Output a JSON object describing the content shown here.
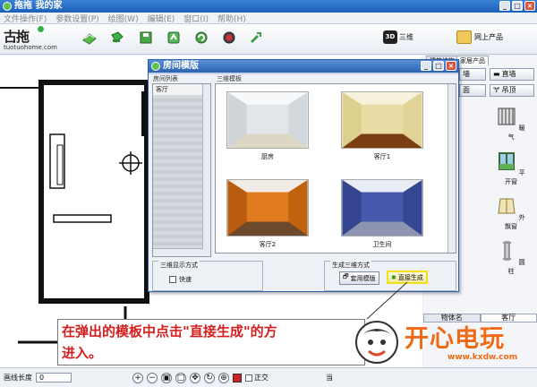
{
  "window": {
    "title": "拖拖 我的家"
  },
  "menu": {
    "items": [
      "文件操作(F)",
      "参数设置(P)",
      "绘图(W)",
      "编辑(E)",
      "窗口(I)",
      "帮助(H)"
    ]
  },
  "logo": {
    "mark": "古拖",
    "site": "tuotuohome.com"
  },
  "toolbar": {
    "view3d_badge": "3D",
    "view3d_label": "三维",
    "shop_label": "网上产品"
  },
  "right_panel": {
    "tabs": [
      "建筑结构",
      "家居产品"
    ],
    "wall_button": "墙",
    "top_button": "直墙",
    "face_button": "面",
    "ceiling_button": "吊顶",
    "items": [
      {
        "label": "暖气"
      },
      {
        "label": "平开窗"
      },
      {
        "label": "外飘窗"
      },
      {
        "label": "圆柱"
      }
    ],
    "object_name_label": "物体名",
    "object_name_value": "客厅"
  },
  "dialog": {
    "title": "房间模版",
    "room_list_label": "房间列表",
    "room_list_selected": "客厅",
    "templates_label": "三维模板",
    "templates": [
      {
        "name": "厨房",
        "color": "#dfe3e6"
      },
      {
        "name": "客厅1",
        "color": "#e6d9a2"
      },
      {
        "name": "客厅2",
        "color": "#e07a1e"
      },
      {
        "name": "卫生间",
        "color": "#3d4fa0"
      }
    ],
    "display_group_label": "三维显示方式",
    "fast_checkbox": "快速",
    "gen_group_label": "生成三维方式",
    "apply_button": "套用模版",
    "generate_button": "直接生成"
  },
  "status": {
    "wall_length_label": "画线长度",
    "wall_length_value": "0",
    "ortho_label": "正交",
    "extra_label": "当"
  },
  "overlay": {
    "line1": "在弹出的模板中点击\"直接生成\"的方",
    "line2": "进入。",
    "watermark_text": "开心电玩",
    "watermark_url": "www.kxdw.com"
  }
}
